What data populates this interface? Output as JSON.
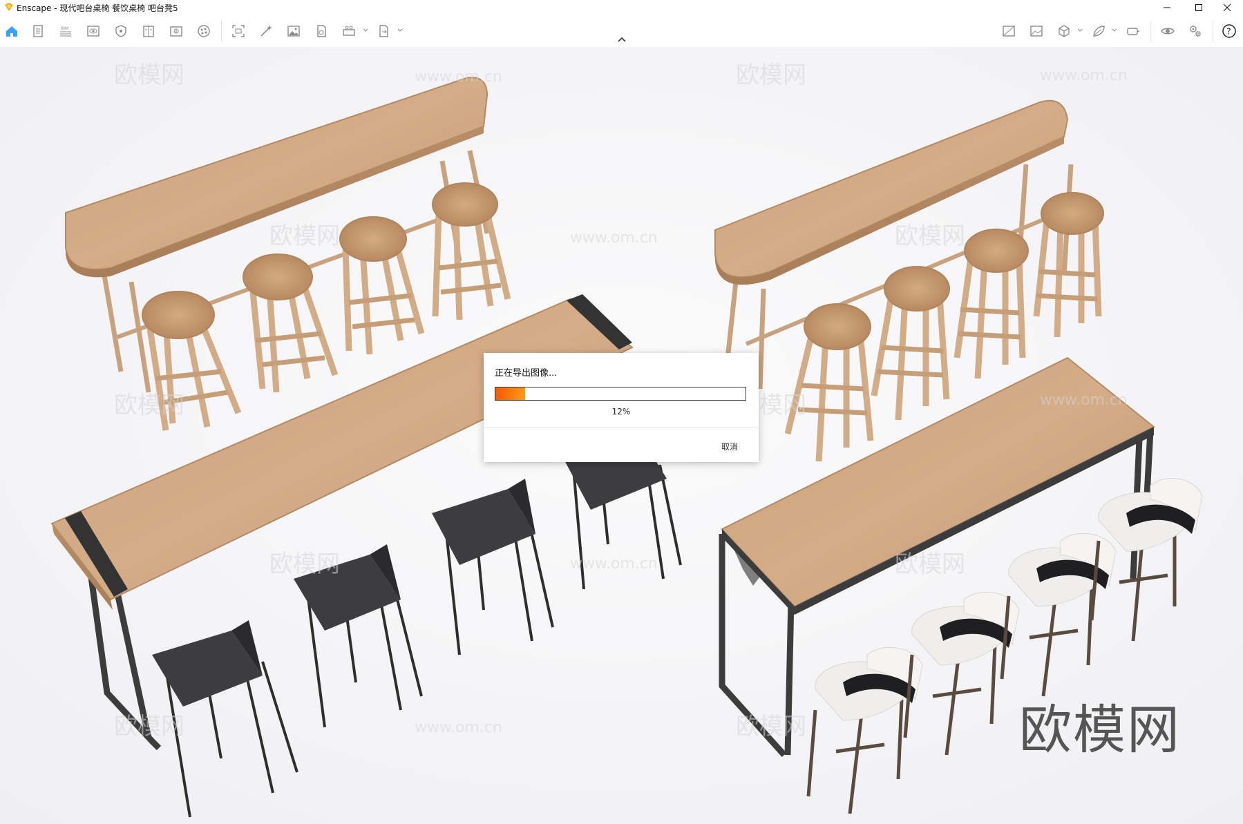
{
  "window": {
    "title": "Enscape - 现代吧台桌椅 餐饮桌椅 吧台凳5",
    "minimize": "minimize",
    "maximize": "maximize",
    "close": "close"
  },
  "toolbar": {
    "left_icons": [
      "home-icon",
      "document-icon",
      "bim-icon",
      "view-icon",
      "shield-icon",
      "book-icon",
      "asset-library-icon",
      "material-icon",
      "screenshot-icon",
      "magic-wand-icon",
      "image-icon",
      "file-export-icon",
      "batch-render-icon",
      "export-icon"
    ],
    "right_icons": [
      "compare-icon",
      "gallery-icon",
      "cube-icon",
      "leaf-icon",
      "vr-headset-icon",
      "visibility-icon",
      "settings-icon",
      "help-icon"
    ],
    "accent": "#3aa0ff"
  },
  "watermark": {
    "brand": "欧模网",
    "site": "www.om.cn"
  },
  "dialog": {
    "title": "正在导出图像...",
    "progress": 0.12,
    "progress_label": "12%",
    "cancel_label": "取消"
  }
}
